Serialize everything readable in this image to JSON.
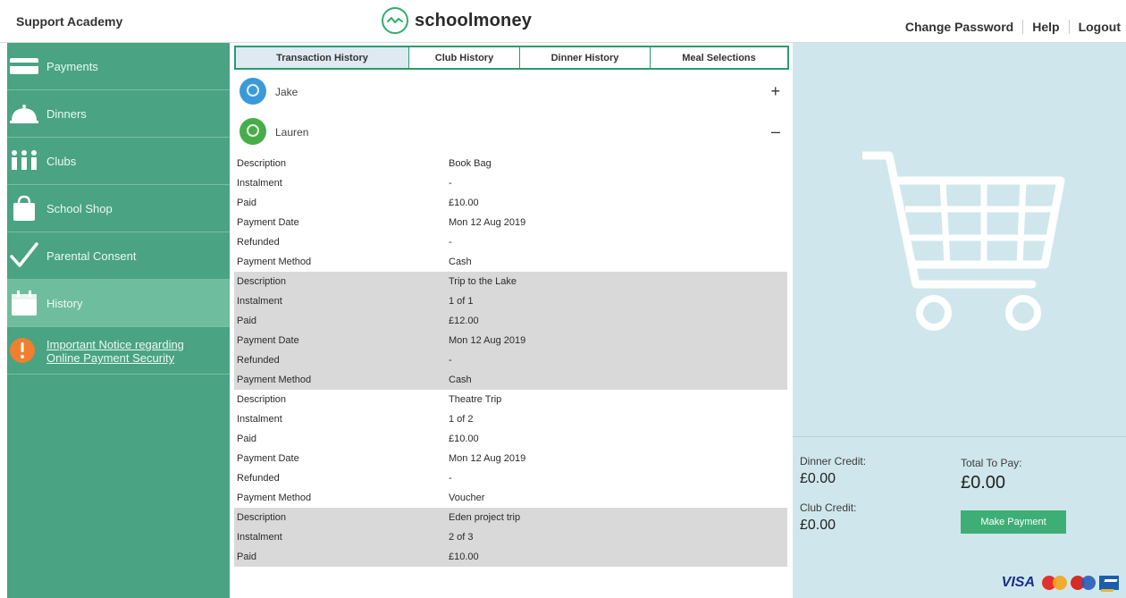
{
  "header": {
    "school_name": "Support Academy",
    "logo_text": "schoolmoney",
    "links": [
      "Change Password",
      "Help",
      "Logout"
    ]
  },
  "sidebar": {
    "items": [
      {
        "label": "Payments",
        "icon": "card-icon"
      },
      {
        "label": "Dinners",
        "icon": "cloche-icon"
      },
      {
        "label": "Clubs",
        "icon": "people-icon"
      },
      {
        "label": "School Shop",
        "icon": "shopping-bag-icon"
      },
      {
        "label": "Parental Consent",
        "icon": "checkmark-icon"
      },
      {
        "label": "History",
        "icon": "calendar-icon",
        "active": true
      }
    ],
    "notice": {
      "line1": "Important Notice regarding",
      "line2": "Online Payment Security",
      "icon": "alert-icon"
    }
  },
  "tabs": [
    "Transaction History",
    "Club History",
    "Dinner History",
    "Meal Selections"
  ],
  "active_tab": "Transaction History",
  "children": [
    {
      "name": "Jake",
      "toggle": "+",
      "avatar_color": "#3a9ad9"
    },
    {
      "name": "Lauren",
      "toggle": "–",
      "avatar_color": "#47ad4a"
    }
  ],
  "field_labels": {
    "description": "Description",
    "instalment": "Instalment",
    "paid": "Paid",
    "payment_date": "Payment Date",
    "refunded": "Refunded",
    "payment_method": "Payment Method"
  },
  "transactions": [
    {
      "description": "Book Bag",
      "instalment": "-",
      "paid": "£10.00",
      "payment_date": "Mon 12 Aug 2019",
      "refunded": "-",
      "payment_method": "Cash"
    },
    {
      "description": "Trip to the Lake",
      "instalment": "1 of 1",
      "paid": "£12.00",
      "payment_date": "Mon 12 Aug 2019",
      "refunded": "-",
      "payment_method": "Cash"
    },
    {
      "description": "Theatre Trip",
      "instalment": "1 of 2",
      "paid": "£10.00",
      "payment_date": "Mon 12 Aug 2019",
      "refunded": "-",
      "payment_method": "Voucher"
    },
    {
      "description": "Eden project trip",
      "instalment": "2 of 3",
      "paid": "£10.00"
    }
  ],
  "basket": {
    "dinner_credit_label": "Dinner Credit:",
    "dinner_credit": "£0.00",
    "club_credit_label": "Club Credit:",
    "club_credit": "£0.00",
    "total_label": "Total To Pay:",
    "total": "£0.00",
    "pay_button": "Make Payment",
    "card_logos": [
      "VISA",
      "mastercard-icon",
      "maestro-icon",
      "amex-icon"
    ]
  },
  "colors": {
    "sidebar": "#4aa383",
    "sidebar_active": "#6fbd9f",
    "accent": "#2a9b6e",
    "right_panel": "#cfe7ec",
    "shaded_row": "#d9d9d9",
    "notice_icon": "#f07f2e"
  }
}
